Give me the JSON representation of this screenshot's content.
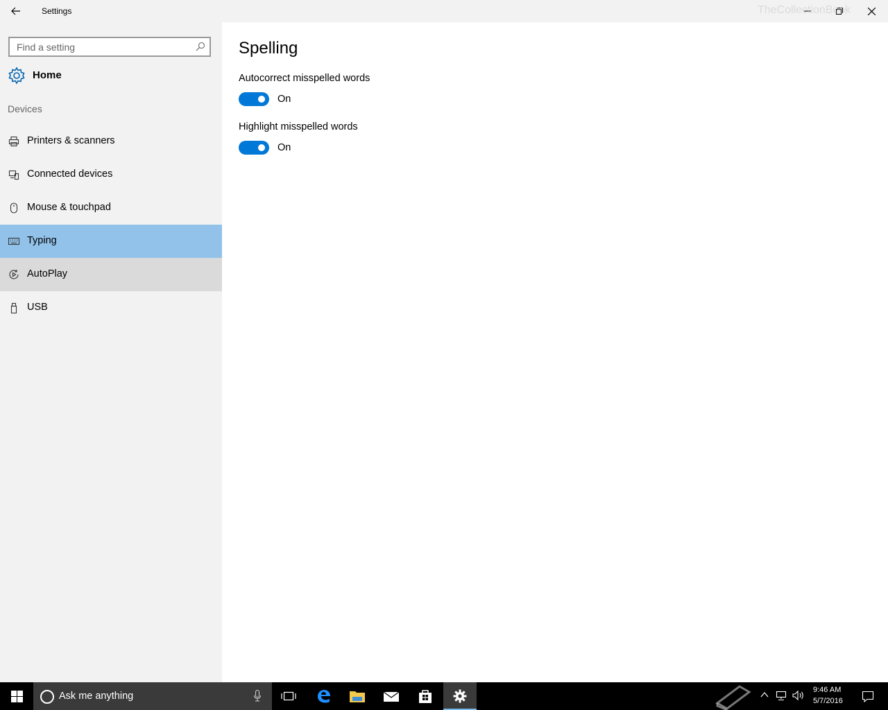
{
  "window": {
    "title": "Settings",
    "back_icon": "back-arrow-icon",
    "minimize_icon": "minimize-icon",
    "restore_icon": "restore-icon",
    "close_icon": "close-icon"
  },
  "sidebar": {
    "search": {
      "placeholder": "Find a setting",
      "value": "",
      "icon": "search-icon"
    },
    "home": {
      "label": "Home",
      "icon": "gear-icon"
    },
    "section_title": "Devices",
    "items": [
      {
        "label": "Printers & scanners",
        "icon": "printer-icon",
        "state": "normal"
      },
      {
        "label": "Connected devices",
        "icon": "connected-devices-icon",
        "state": "normal"
      },
      {
        "label": "Mouse & touchpad",
        "icon": "mouse-icon",
        "state": "normal"
      },
      {
        "label": "Typing",
        "icon": "keyboard-icon",
        "state": "selected"
      },
      {
        "label": "AutoPlay",
        "icon": "autoplay-icon",
        "state": "hover"
      },
      {
        "label": "USB",
        "icon": "usb-icon",
        "state": "normal"
      }
    ]
  },
  "content": {
    "heading": "Spelling",
    "settings": [
      {
        "label": "Autocorrect misspelled words",
        "state_label": "On",
        "on": true
      },
      {
        "label": "Highlight misspelled words",
        "state_label": "On",
        "on": true
      }
    ]
  },
  "taskbar": {
    "search_placeholder": "Ask me anything",
    "apps": [
      "start-icon",
      "task-view-icon",
      "edge-icon",
      "file-explorer-icon",
      "mail-icon",
      "store-icon",
      "settings-icon"
    ],
    "time": "9:46 AM",
    "date": "5/7/2016",
    "watermark": "TheCollectionBook"
  },
  "colors": {
    "accent": "#0078d7",
    "selected_bg": "#92c2e9",
    "hover_bg": "#dadada",
    "sidebar_bg": "#f2f2f2",
    "taskbar_bg": "#000000"
  }
}
